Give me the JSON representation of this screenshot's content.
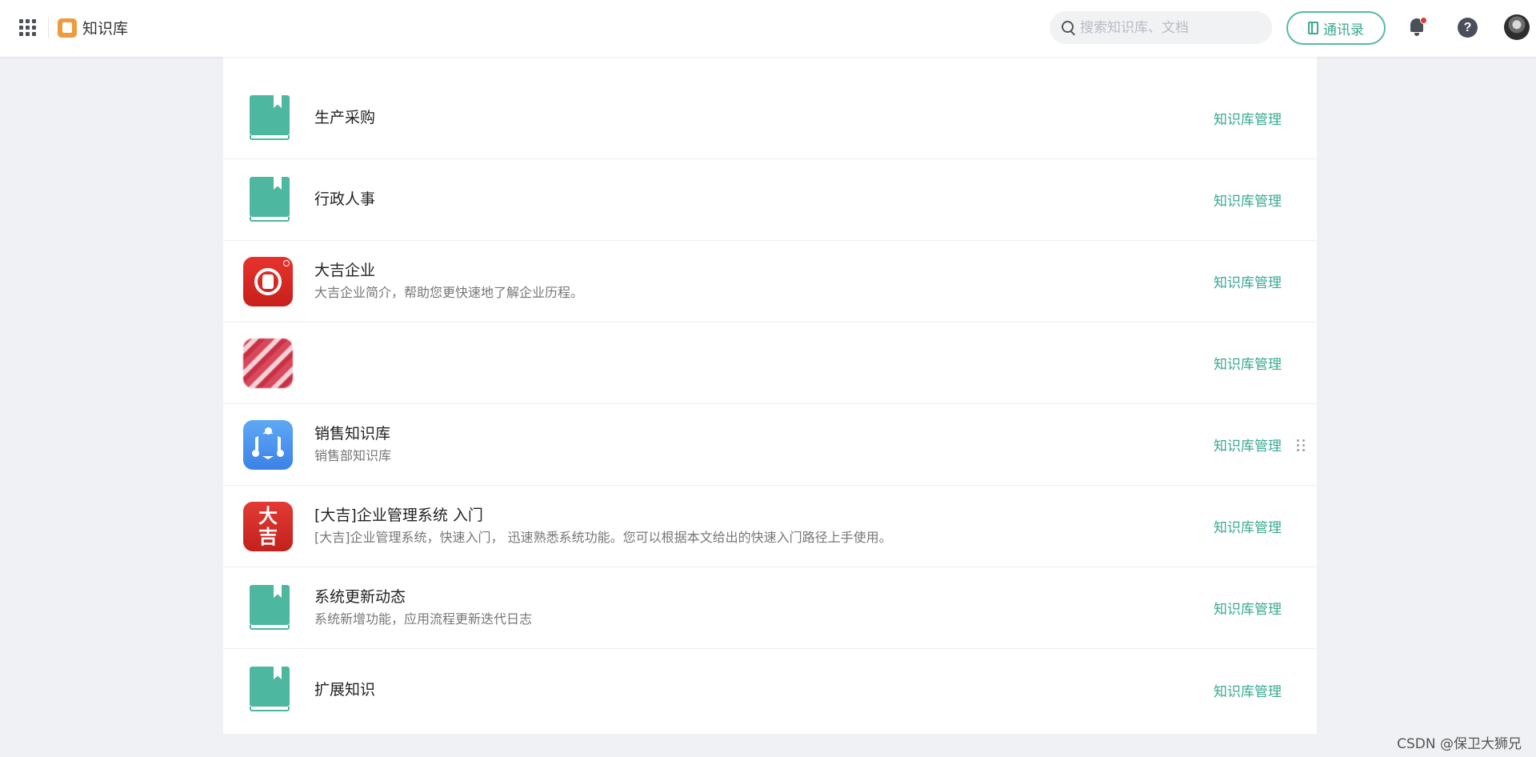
{
  "header": {
    "app_title": "知识库",
    "search_placeholder": "搜索知识库、文档",
    "contacts_label": "通讯录",
    "help_label": "?"
  },
  "knowledge_bases": [
    {
      "title": "生产采购",
      "description": "",
      "icon": "book-icon",
      "action": "知识库管理"
    },
    {
      "title": "行政人事",
      "description": "",
      "icon": "book-icon",
      "action": "知识库管理"
    },
    {
      "title": "大吉企业",
      "description": "大吉企业简介，帮助您更快速地了解企业历程。",
      "icon": "company-logo-icon",
      "action": "知识库管理"
    },
    {
      "title": "",
      "description": "",
      "icon": "blurred-image-icon",
      "action": "知识库管理"
    },
    {
      "title": "销售知识库",
      "description": "销售部知识库",
      "icon": "hexagon-network-icon",
      "action": "知识库管理"
    },
    {
      "title": "[大吉]企业管理系统 入门",
      "description": "[大吉]企业管理系统，快速入门， 迅速熟悉系统功能。您可以根据本文给出的快速入门路径上手使用。",
      "icon": "dj-character-icon",
      "action": "知识库管理"
    },
    {
      "title": "系统更新动态",
      "description": "系统新增功能，应用流程更新迭代日志",
      "icon": "book-icon",
      "action": "知识库管理"
    },
    {
      "title": "扩展知识",
      "description": "",
      "icon": "book-icon",
      "action": "知识库管理"
    }
  ],
  "charlogo": {
    "line1": "大",
    "line2": "吉"
  },
  "watermark": "CSDN @保卫大狮兄",
  "colors": {
    "accent": "#3aa892",
    "book": "#4db89f",
    "red_logo": "#d9281f",
    "blue_logo": "#4a93ee",
    "notification_dot": "#e53935"
  }
}
